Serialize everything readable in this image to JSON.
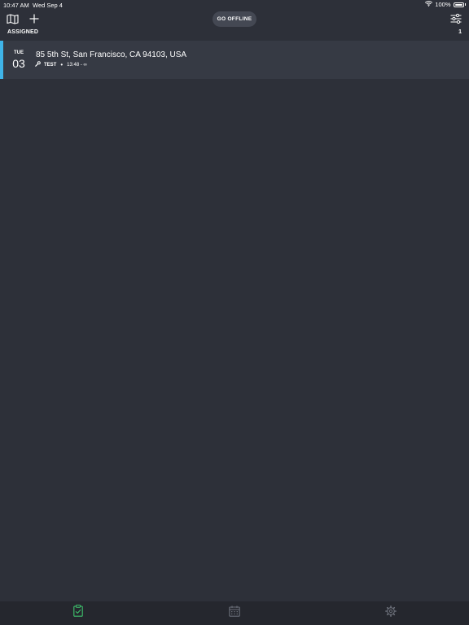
{
  "status_bar": {
    "time": "10:47 AM",
    "date": "Wed Sep 4",
    "battery": "100%",
    "wifi_icon": "wifi-icon",
    "battery_icon": "battery-icon"
  },
  "header": {
    "map_icon": "map-icon",
    "add_icon": "plus-icon",
    "go_offline_label": "GO OFFLINE",
    "filter_icon": "sliders-icon"
  },
  "section": {
    "label": "ASSIGNED",
    "count": "1"
  },
  "jobs": [
    {
      "day_of_week": "TUE",
      "day": "03",
      "address": "85 5th St, San Francisco, CA 94103, USA",
      "type_icon": "wrench-icon",
      "type": "TEST",
      "time": "13:48 - ∞",
      "accent_color": "#3fb4e8"
    }
  ],
  "tab_bar": {
    "tabs": [
      {
        "icon": "clipboard-check-icon",
        "active": true,
        "color": "#3ec46d"
      },
      {
        "icon": "calendar-icon",
        "active": false,
        "color": "#6a6e78"
      },
      {
        "icon": "gear-icon",
        "active": false,
        "color": "#6a6e78"
      }
    ]
  }
}
